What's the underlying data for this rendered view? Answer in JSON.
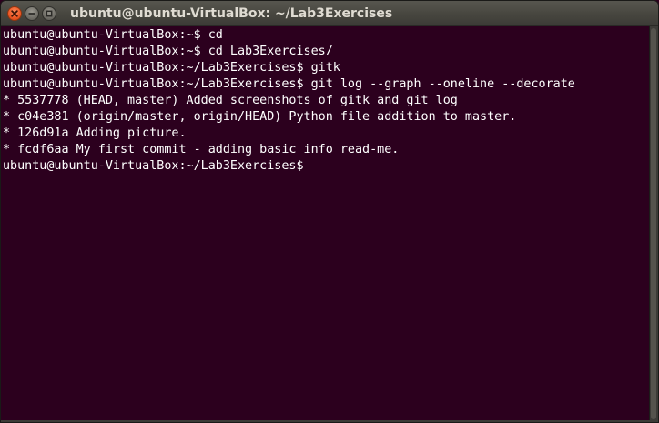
{
  "window": {
    "title": "ubuntu@ubuntu-VirtualBox: ~/Lab3Exercises",
    "controls": {
      "close_icon": "close-icon",
      "minimize_icon": "minimize-icon",
      "maximize_icon": "maximize-icon"
    }
  },
  "terminal": {
    "lines": [
      "ubuntu@ubuntu-VirtualBox:~$ cd",
      "ubuntu@ubuntu-VirtualBox:~$ cd Lab3Exercises/",
      "ubuntu@ubuntu-VirtualBox:~/Lab3Exercises$ gitk",
      "ubuntu@ubuntu-VirtualBox:~/Lab3Exercises$ git log --graph --oneline --decorate",
      "* 5537778 (HEAD, master) Added screenshots of gitk and git log",
      "* c04e381 (origin/master, origin/HEAD) Python file addition to master.",
      "* 126d91a Adding picture.",
      "* fcdf6aa My first commit - adding basic info read-me.",
      "ubuntu@ubuntu-VirtualBox:~/Lab3Exercises$ "
    ]
  },
  "colors": {
    "background": "#2c001e",
    "text": "#ffffff",
    "titlebar": "#3c3b37",
    "close_button": "#ee5a28"
  }
}
